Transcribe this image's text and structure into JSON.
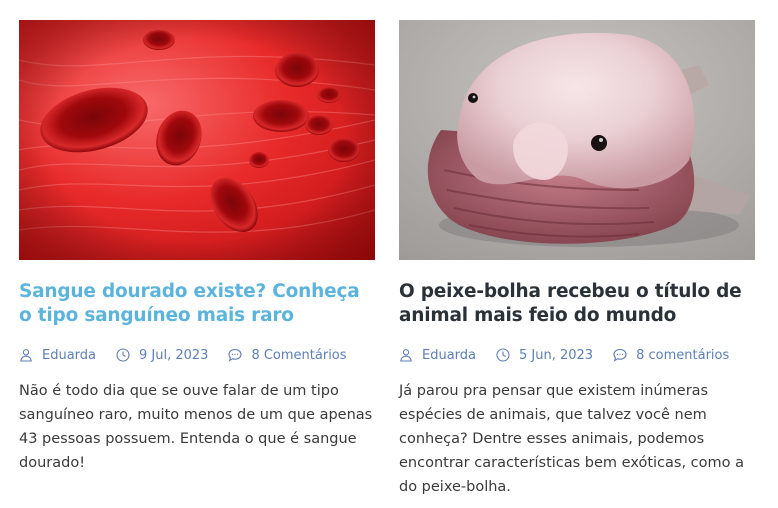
{
  "posts": [
    {
      "title": "Sangue dourado existe? Conheça o tipo sanguíneo mais raro",
      "author": "Eduarda",
      "date": "9 Jul, 2023",
      "comments": "8 Comentários",
      "excerpt": "Não é todo dia que se ouve falar de um tipo sanguíneo raro, muito menos de um que apenas 43 pessoas possuem. Entenda o que é sangue dourado!",
      "image_subject": "red blood cells in a vessel",
      "title_color": "#5cb4dc"
    },
    {
      "title": "O peixe-bolha recebeu o título de animal mais feio do mundo",
      "author": "Eduarda",
      "date": "5 Jun, 2023",
      "comments": "8 comentários",
      "excerpt": "Já parou pra pensar que existem inúmeras espécies de animais, que talvez você nem conheça? Dentre esses animais, podemos encontrar características bem exóticas, como a do peixe-bolha.",
      "image_subject": "blobfish on grey background",
      "title_color": "#2b3138"
    }
  ],
  "icons": {
    "author": "user-icon",
    "date": "clock-icon",
    "comments": "comment-icon"
  },
  "meta_color": "#5e7fb5"
}
